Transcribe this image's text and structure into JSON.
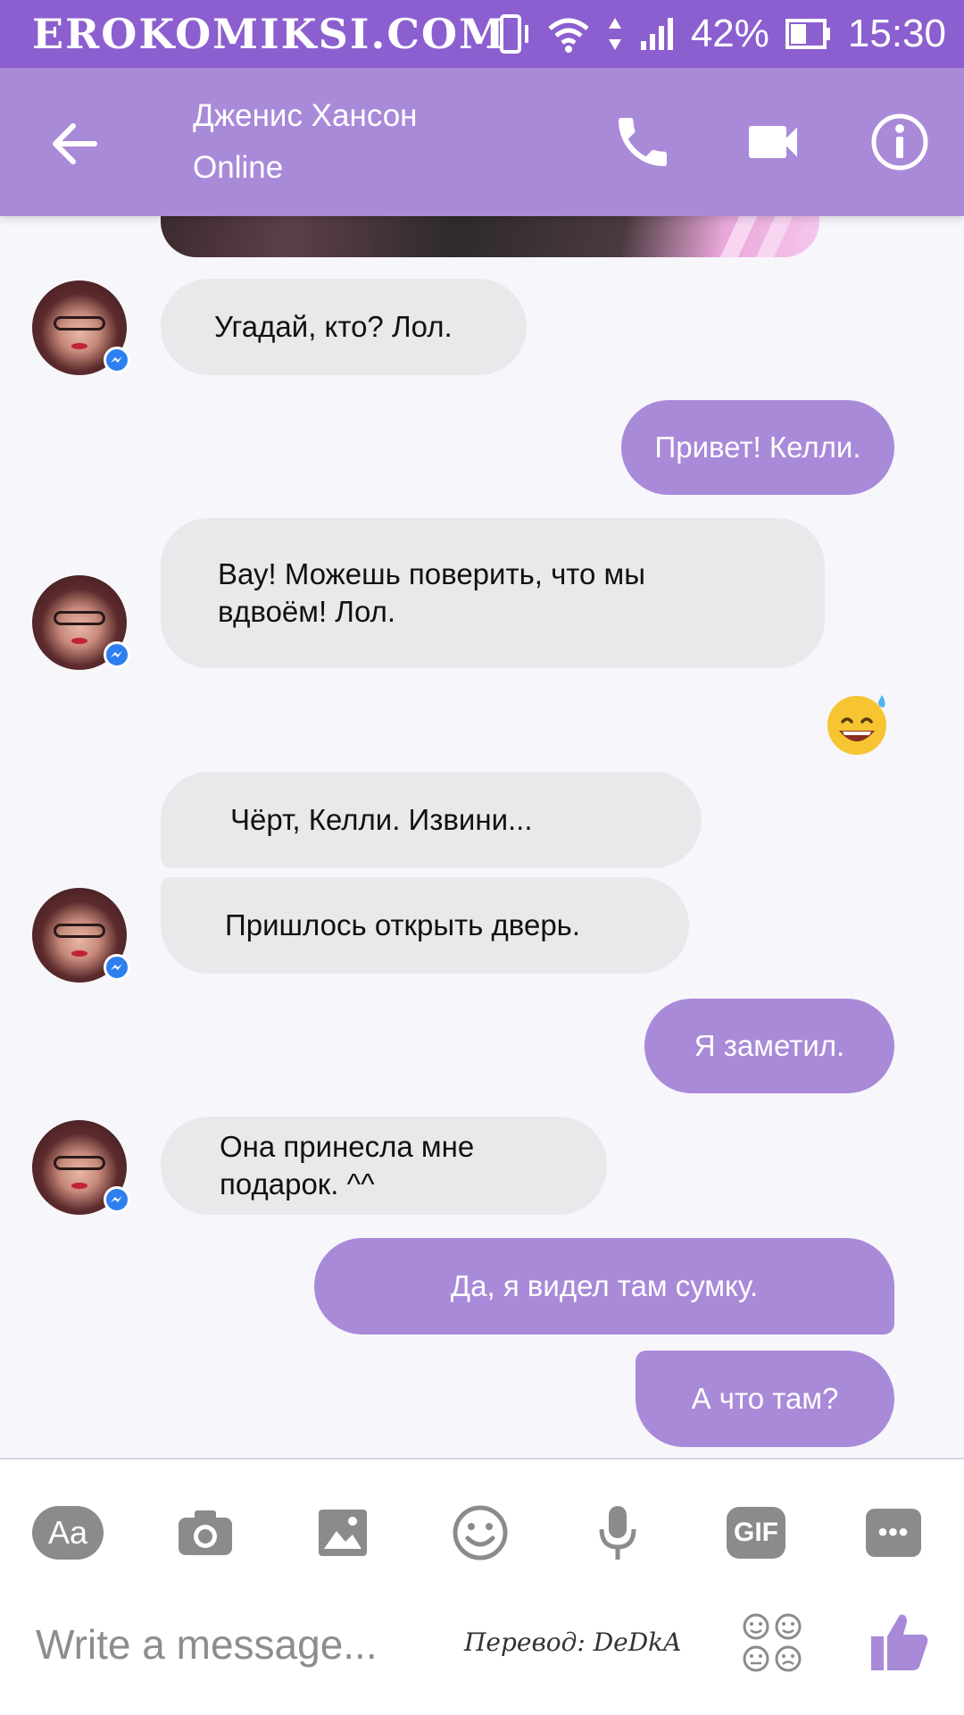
{
  "status_bar": {
    "brand": "EROKOMIKSI.COM",
    "battery": "42%",
    "time": "15:30",
    "icons": [
      "vibrate-icon",
      "wifi-icon",
      "data-arrows-icon",
      "signal-icon",
      "battery-icon"
    ]
  },
  "header": {
    "contact_name": "Дженис Хансон",
    "status": "Online",
    "icons": [
      "back-arrow-icon",
      "phone-icon",
      "video-camera-icon",
      "info-icon"
    ]
  },
  "messages": [
    {
      "side": "in",
      "lines": [
        "Угадай, кто? Лол."
      ]
    },
    {
      "side": "out",
      "lines": [
        "Привет! Келли."
      ]
    },
    {
      "side": "in",
      "lines": [
        "Вау! Можешь поверить, что мы",
        "вдвоём! Лол."
      ]
    },
    {
      "side": "in",
      "lines": [
        "Чёрт, Келли. Извини..."
      ]
    },
    {
      "side": "in",
      "lines": [
        "Пришлось открыть дверь."
      ]
    },
    {
      "side": "out",
      "lines": [
        "Я заметил."
      ]
    },
    {
      "side": "in",
      "lines": [
        "Она принесла мне",
        "подарок. ^^"
      ]
    },
    {
      "side": "out",
      "lines": [
        "Да, я видел там сумку."
      ]
    },
    {
      "side": "out",
      "lines": [
        "А что там?"
      ]
    }
  ],
  "reaction_emoji": "grinning-sweat-emoji",
  "composer": {
    "aa_label": "Aa",
    "gif_label": "GIF",
    "more_label": "•••",
    "placeholder": "Write a message...",
    "credit": "Перевод: DeDkA",
    "icons": [
      "camera-icon",
      "image-icon",
      "smiley-icon",
      "microphone-icon",
      "stickers-icon",
      "thumbs-up-icon"
    ]
  },
  "colors": {
    "status_bar": "#8b5fcf",
    "header": "#a98ad9",
    "outgoing_bubble": "#a98ad9",
    "incoming_bubble": "#e9e8eb",
    "background": "#f7f6fb",
    "tool_icons": "#8b8b8b"
  }
}
